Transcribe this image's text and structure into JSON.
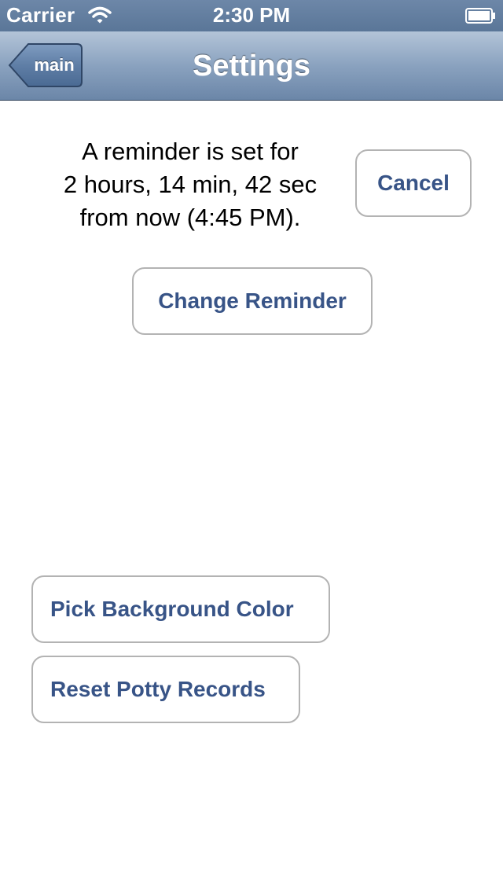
{
  "status_bar": {
    "carrier": "Carrier",
    "time": "2:30 PM",
    "wifi_icon": "wifi-icon",
    "battery_icon": "battery-icon"
  },
  "nav_bar": {
    "back_label": "main",
    "title": "Settings",
    "colors": {
      "bar_top": "#b3c4d8",
      "bar_bottom": "#6b86a8",
      "back_button": "#5f7ea6"
    }
  },
  "reminder": {
    "lines": [
      "A reminder is set for",
      "2 hours, 14 min, 42 sec",
      "from now (4:45 PM)."
    ]
  },
  "buttons": {
    "cancel": "Cancel",
    "change_reminder": "Change Reminder",
    "pick_background_color": "Pick Background Color",
    "reset_potty_records": "Reset Potty Records",
    "text_color": "#385487",
    "border_color": "#b3b3b3"
  }
}
